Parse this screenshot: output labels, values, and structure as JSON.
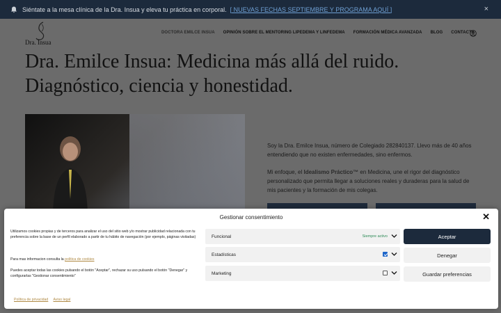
{
  "announcement": {
    "text": "Siéntate a la mesa clínica de la Dra. Insua y eleva tu práctica en corporal.",
    "link": "[ NUEVAS FECHAS SEPTIEMBRE Y PROGRAMA AQUÍ ]",
    "close": "×"
  },
  "header": {
    "logo_text": "Dra. Insua",
    "nav": [
      "DOCTORA EMILCE INSUA",
      "OPINIÓN SOBRE EL MENTORING LIPEDEMA Y LINFEDEMA",
      "FORMACIÓN MÉDICA AVANZADA",
      "BLOG",
      "CONTACTA"
    ]
  },
  "hero": {
    "title_line1": "Dra. Emilce Insua: Medicina más allá del ruido.",
    "title_line2": "Diagnóstico, ciencia y honestidad."
  },
  "intro": {
    "p1": "Soy la Dra. Emilce Insua, número de Colegiado 282840137. Llevo más de 40 años entendiendo que no existen enfermedades, sino enfermos.",
    "p2_before": "Mi enfoque, el ",
    "p2_strong": "Idealismo Práctico™",
    "p2_after": " en Medicina, une el rigor del diagnóstico personalizado que permita llegar a soluciones reales y duraderas para la salud de mis pacientes y la formación de mis colegas."
  },
  "consent": {
    "title": "Gestionar consentimiento",
    "close": "✕",
    "text1": "Utilizamos cookies propias y de terceros para analizar el uso del sitio web y/o mostrar publicidad relacionada con tu preferencia sobre la base de un perfil elaborado a partir de tu hábito de navegación (por ejemplo, páginas visitadas)",
    "text2_prefix": "Para mas informacion consulta la ",
    "text2_link": "politica de cookies",
    "text3": "Puedes aceptar todas las cookies pulsando el botón \"Aceptar\", rechazar su uso pulsando el botón \"Denegar\" y configurarlas \"Gestionar consentimiento\"",
    "categories": [
      {
        "label": "Funcional",
        "status": "Siempre activo"
      },
      {
        "label": "Estadísticas"
      },
      {
        "label": "Marketing"
      }
    ],
    "accept_label": "Aceptar",
    "deny_label": "Denegar",
    "prefs_label": "Guardar preferencias",
    "privacy_link": "Política de privacidad",
    "legal_link": "Aviso legal"
  }
}
